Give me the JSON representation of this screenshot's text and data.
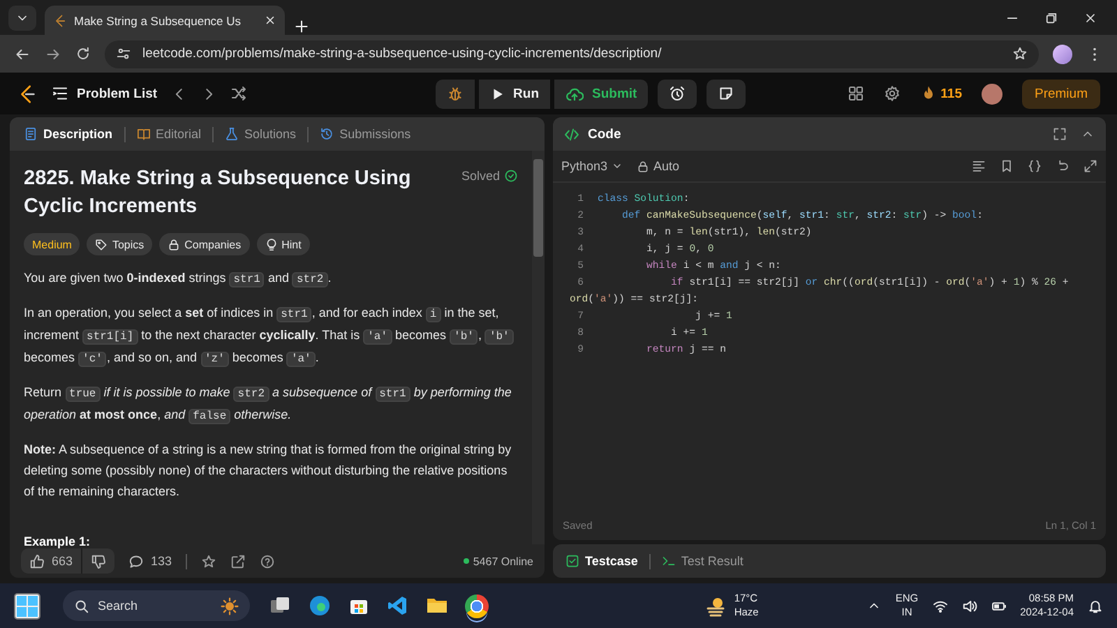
{
  "browser": {
    "tab_title": "Make String a Subsequence Us",
    "url": "leetcode.com/problems/make-string-a-subsequence-using-cyclic-increments/description/"
  },
  "navbar": {
    "problem_list": "Problem List",
    "run": "Run",
    "submit": "Submit",
    "streak": "115",
    "premium": "Premium"
  },
  "description_panel": {
    "tabs": [
      {
        "label": "Description",
        "selected": true,
        "kind": "description"
      },
      {
        "label": "Editorial",
        "selected": false,
        "kind": "editorial"
      },
      {
        "label": "Solutions",
        "selected": false,
        "kind": "solutions"
      },
      {
        "label": "Submissions",
        "selected": false,
        "kind": "submissions"
      }
    ],
    "title": "2825. Make String a Subsequence Using Cyclic Increments",
    "status": "Solved",
    "tags": [
      {
        "label": "Medium",
        "kind": "difficulty"
      },
      {
        "label": "Topics",
        "kind": "topics"
      },
      {
        "label": "Companies",
        "kind": "companies"
      },
      {
        "label": "Hint",
        "kind": "hint"
      }
    ],
    "paragraphs": [
      [
        {
          "kind": "text",
          "text": "You are given two **0-indexed** strings "
        },
        {
          "kind": "code",
          "text": "str1"
        },
        {
          "kind": "text",
          "text": " and "
        },
        {
          "kind": "code",
          "text": "str2"
        },
        {
          "kind": "text",
          "text": "."
        }
      ],
      [
        {
          "kind": "text",
          "text": "In an operation, you select a **set** of indices in "
        },
        {
          "kind": "code",
          "text": "str1"
        },
        {
          "kind": "text",
          "text": ", and for each index "
        },
        {
          "kind": "code",
          "text": "i"
        },
        {
          "kind": "text",
          "text": " in the set, increment "
        },
        {
          "kind": "code",
          "text": "str1[i]"
        },
        {
          "kind": "text",
          "text": " to the next character **cyclically**. That is "
        },
        {
          "kind": "code",
          "text": "'a'"
        },
        {
          "kind": "text",
          "text": " becomes "
        },
        {
          "kind": "code",
          "text": "'b'"
        },
        {
          "kind": "text",
          "text": ", "
        },
        {
          "kind": "code",
          "text": "'b'"
        },
        {
          "kind": "text",
          "text": " becomes "
        },
        {
          "kind": "code",
          "text": "'c'"
        },
        {
          "kind": "text",
          "text": ", and so on, and "
        },
        {
          "kind": "code",
          "text": "'z'"
        },
        {
          "kind": "text",
          "text": " becomes "
        },
        {
          "kind": "code",
          "text": "'a'"
        },
        {
          "kind": "text",
          "text": "."
        }
      ],
      [
        {
          "kind": "text",
          "text": "Return "
        },
        {
          "kind": "code",
          "text": "true"
        },
        {
          "kind": "text",
          "text": " *if it is possible to make* "
        },
        {
          "kind": "code",
          "text": "str2"
        },
        {
          "kind": "text",
          "text": " *a subsequence of* "
        },
        {
          "kind": "code",
          "text": "str1"
        },
        {
          "kind": "text",
          "text": " *by performing the operation* **at most once**, *and* "
        },
        {
          "kind": "code",
          "text": "false"
        },
        {
          "kind": "text",
          "text": " *otherwise.*"
        }
      ],
      [
        {
          "kind": "text",
          "text": "**Note:** A subsequence of a string is a new string that is formed from the original string by deleting some (possibly none) of the characters without disturbing the relative positions of the remaining characters."
        }
      ]
    ],
    "example_heading": "Example 1:",
    "likes": "663",
    "comments": "133",
    "online": "5467 Online"
  },
  "code_panel": {
    "title": "Code",
    "language": "Python3",
    "mode": "Auto",
    "lines": [
      {
        "number": "1",
        "tokens": [
          {
            "kind": "keyword",
            "text": "class "
          },
          {
            "kind": "type",
            "text": "Solution"
          },
          {
            "kind": "plain",
            "text": ":"
          }
        ]
      },
      {
        "number": "2",
        "tokens": [
          {
            "kind": "keyword",
            "text": "    def "
          },
          {
            "kind": "function",
            "text": "canMakeSubsequence"
          },
          {
            "kind": "plain",
            "text": "("
          },
          {
            "kind": "variable",
            "text": "self"
          },
          {
            "kind": "plain",
            "text": ", "
          },
          {
            "kind": "variable",
            "text": "str1"
          },
          {
            "kind": "plain",
            "text": ": "
          },
          {
            "kind": "type",
            "text": "str"
          },
          {
            "kind": "plain",
            "text": ", "
          },
          {
            "kind": "variable",
            "text": "str2"
          },
          {
            "kind": "plain",
            "text": ": "
          },
          {
            "kind": "type",
            "text": "str"
          },
          {
            "kind": "plain",
            "text": ") -> "
          },
          {
            "kind": "keyword",
            "text": "bool"
          },
          {
            "kind": "plain",
            "text": ":"
          }
        ]
      },
      {
        "number": "3",
        "tokens": [
          {
            "kind": "plain",
            "text": "        m, n = "
          },
          {
            "kind": "function",
            "text": "len"
          },
          {
            "kind": "plain",
            "text": "(str1), "
          },
          {
            "kind": "function",
            "text": "len"
          },
          {
            "kind": "plain",
            "text": "(str2)"
          }
        ]
      },
      {
        "number": "4",
        "tokens": [
          {
            "kind": "plain",
            "text": "        i, j = "
          },
          {
            "kind": "number",
            "text": "0"
          },
          {
            "kind": "plain",
            "text": ", "
          },
          {
            "kind": "number",
            "text": "0"
          }
        ]
      },
      {
        "number": "5",
        "tokens": [
          {
            "kind": "control",
            "text": "        while"
          },
          {
            "kind": "plain",
            "text": " i < m "
          },
          {
            "kind": "keyword",
            "text": "and"
          },
          {
            "kind": "plain",
            "text": " j < n:"
          }
        ]
      },
      {
        "number": "6",
        "tokens": [
          {
            "kind": "control",
            "text": "            if"
          },
          {
            "kind": "plain",
            "text": " str1[i] == str2[j] "
          },
          {
            "kind": "keyword",
            "text": "or "
          },
          {
            "kind": "function",
            "text": "chr"
          },
          {
            "kind": "plain",
            "text": "(("
          },
          {
            "kind": "function",
            "text": "ord"
          },
          {
            "kind": "plain",
            "text": "(str1[i]) - "
          },
          {
            "kind": "function",
            "text": "ord"
          },
          {
            "kind": "plain",
            "text": "("
          },
          {
            "kind": "string",
            "text": "'a'"
          },
          {
            "kind": "plain",
            "text": ") + "
          },
          {
            "kind": "number",
            "text": "1"
          },
          {
            "kind": "plain",
            "text": ") % "
          },
          {
            "kind": "number",
            "text": "26"
          },
          {
            "kind": "plain",
            "text": " +"
          }
        ],
        "continuation": [
          {
            "kind": "function",
            "text": "ord"
          },
          {
            "kind": "plain",
            "text": "("
          },
          {
            "kind": "string",
            "text": "'a'"
          },
          {
            "kind": "plain",
            "text": ")) == str2[j]:"
          }
        ]
      },
      {
        "number": "7",
        "tokens": [
          {
            "kind": "plain",
            "text": "                j += "
          },
          {
            "kind": "number",
            "text": "1"
          }
        ]
      },
      {
        "number": "8",
        "tokens": [
          {
            "kind": "plain",
            "text": "            i += "
          },
          {
            "kind": "number",
            "text": "1"
          }
        ]
      },
      {
        "number": "9",
        "tokens": [
          {
            "kind": "control",
            "text": "        return"
          },
          {
            "kind": "plain",
            "text": " j == n"
          }
        ]
      }
    ],
    "status": "Saved",
    "cursor": "Ln 1, Col 1"
  },
  "bottom_panel": {
    "tabs": [
      {
        "label": "Testcase",
        "selected": true
      },
      {
        "label": "Test Result",
        "selected": false
      }
    ]
  },
  "taskbar": {
    "search": "Search",
    "temperature": "17°C",
    "weather": "Haze",
    "language": "ENG",
    "region": "IN",
    "time": "08:58 PM",
    "date": "2024-12-04"
  }
}
